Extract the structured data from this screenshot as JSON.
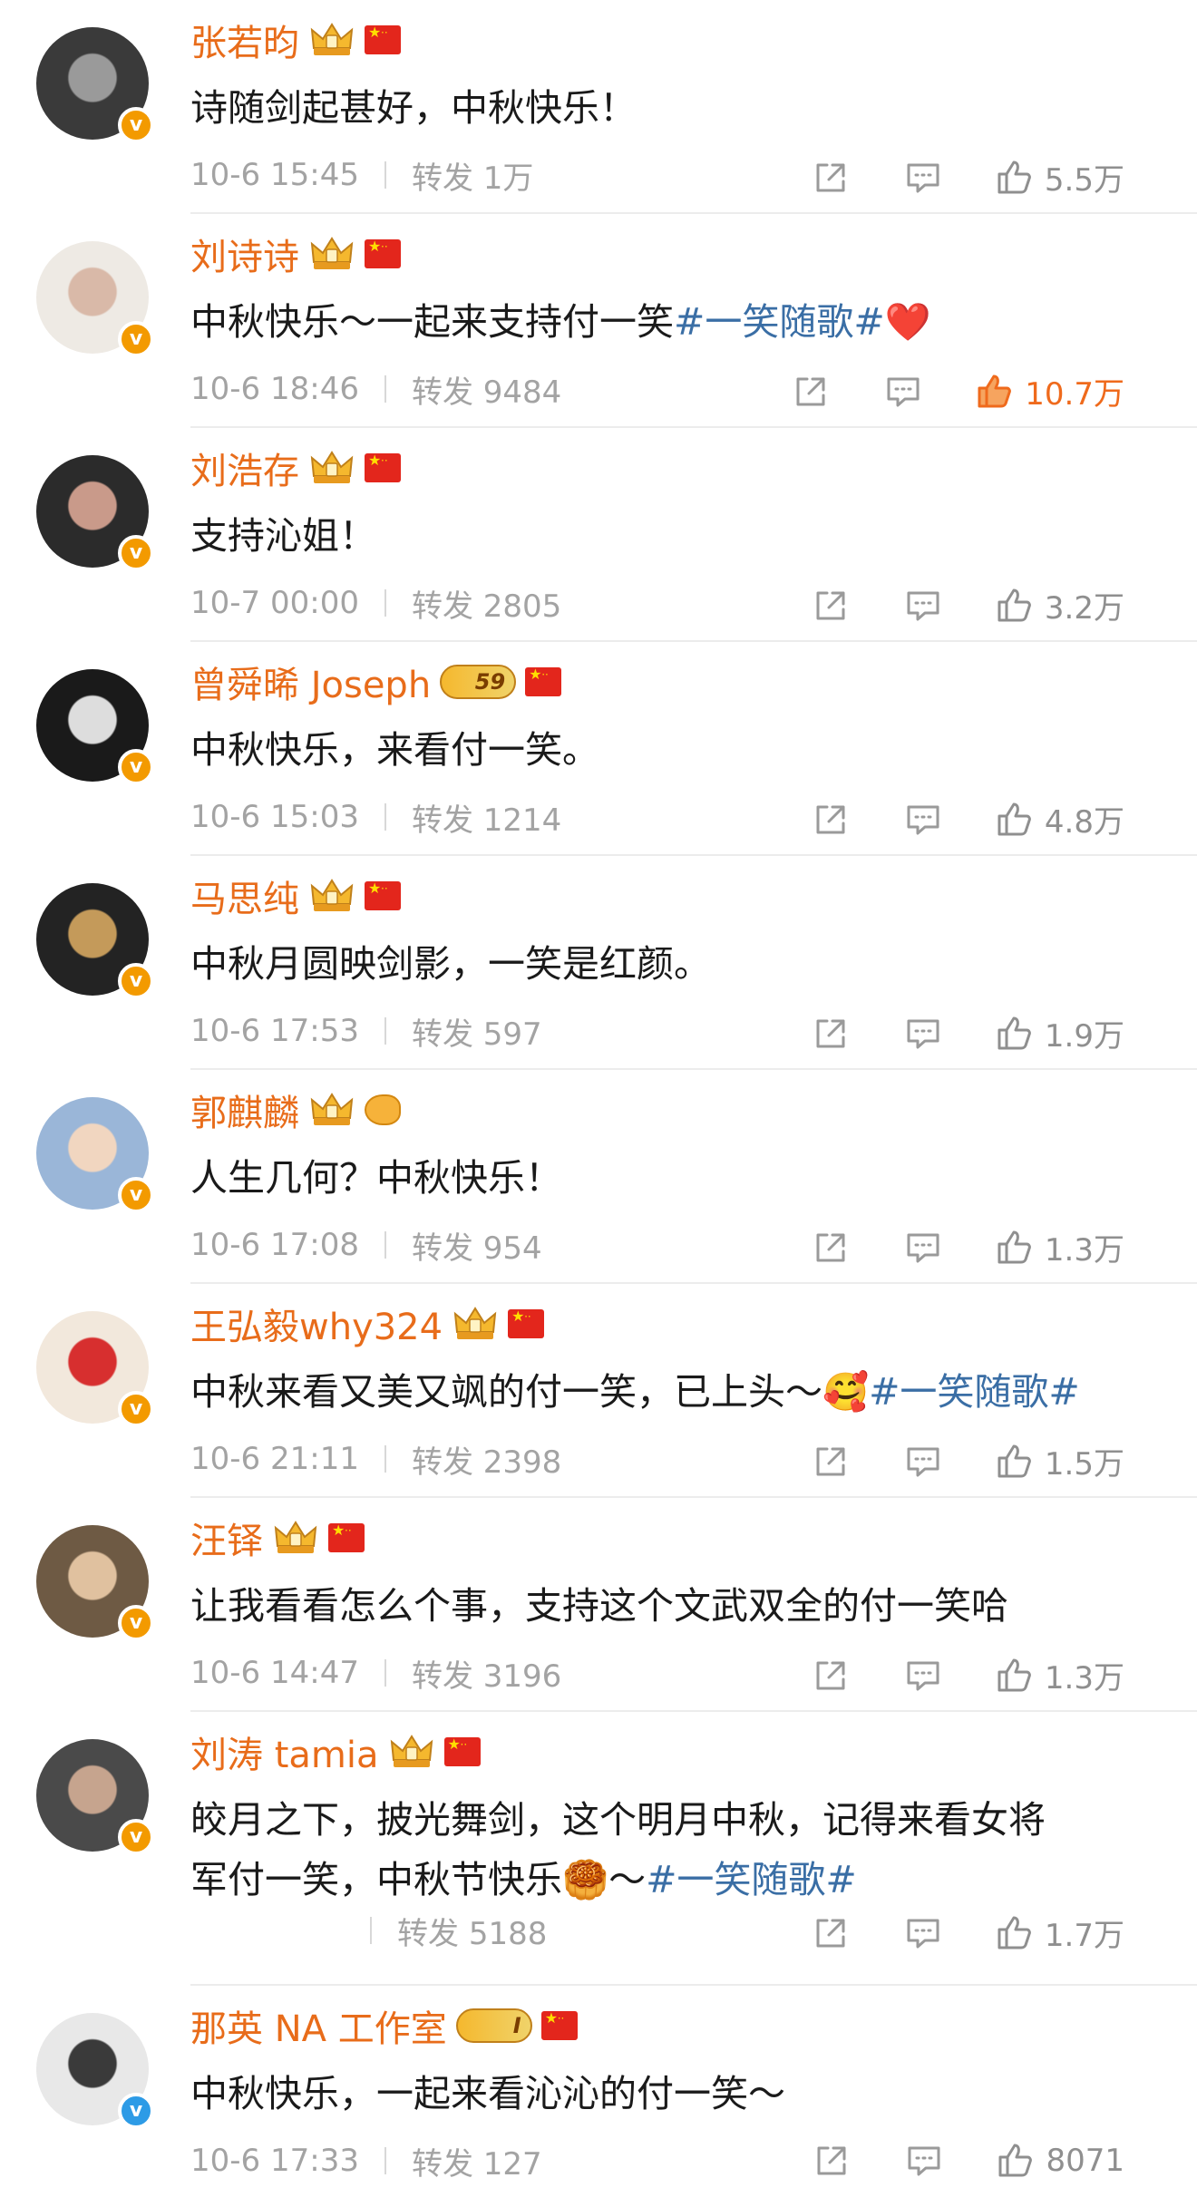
{
  "colors": {
    "name": "#e86c1a",
    "text": "#1a1a1a",
    "meta": "#a3a3a3",
    "hashtag": "#3a6ea5",
    "like_active": "#ef6a1c",
    "verified_orange": "#f39a00",
    "verified_blue": "#2d9be6"
  },
  "labels": {
    "repost": "转发"
  },
  "posts": [
    {
      "name": "张若昀",
      "line1": "诗随剑起甚好，中秋快乐！",
      "time": "10-6 15:45",
      "reposts": "1万",
      "likes": "5.5万",
      "liked": false,
      "verified": "orange",
      "badge": "crown-icon"
    },
    {
      "name": "刘诗诗",
      "line1": "中秋快乐～一起来支持付一笑",
      "tag": "#一笑随歌#",
      "emoji": "❤️",
      "time": "10-6 18:46",
      "reposts": "9484",
      "likes": "10.7万",
      "liked": true,
      "verified": "orange",
      "badge": "crown-icon"
    },
    {
      "name": "刘浩存",
      "line1": "支持沁姐！",
      "time": "10-7 00:00",
      "reposts": "2805",
      "likes": "3.2万",
      "liked": false,
      "verified": "orange",
      "badge": "crown-icon"
    },
    {
      "name": "曾舜晞 Joseph",
      "line1": "中秋快乐，来看付一笑。",
      "time": "10-6 15:03",
      "reposts": "1214",
      "likes": "4.8万",
      "liked": false,
      "verified": "orange",
      "badge": "level-badge",
      "level": "59"
    },
    {
      "name": "马思纯",
      "line1": "中秋月圆映剑影，一笑是红颜。",
      "time": "10-6 17:53",
      "reposts": "597",
      "likes": "1.9万",
      "liked": false,
      "verified": "orange",
      "badge": "crown-icon"
    },
    {
      "name": "郭麒麟",
      "line1": "人生几何？中秋快乐！",
      "time": "10-6 17:08",
      "reposts": "954",
      "likes": "1.3万",
      "liked": false,
      "verified": "orange",
      "badge": "crown-icon",
      "extra": "fish-icon"
    },
    {
      "name": "王弘毅why324",
      "line1": "中秋来看又美又飒的付一笑，已上头～",
      "emoji": "🥰",
      "tag": "#一笑随歌#",
      "time": "10-6 21:11",
      "reposts": "2398",
      "likes": "1.5万",
      "liked": false,
      "verified": "orange",
      "badge": "crown-icon"
    },
    {
      "name": "汪铎",
      "line1": "让我看看怎么个事，支持这个文武双全的付一笑哈",
      "time": "10-6 14:47",
      "reposts": "3196",
      "likes": "1.3万",
      "liked": false,
      "verified": "orange",
      "badge": "crown-icon"
    },
    {
      "name": "刘涛 tamia",
      "line1": "皎月之下，披光舞剑，这个明月中秋，记得来看女将",
      "line2": "军付一笑，中秋节快乐",
      "emoji2": "🥮",
      "line2b": "～",
      "tag2": "#一笑随歌#",
      "time": "",
      "reposts": "5188",
      "likes": "1.7万",
      "liked": false,
      "verified": "orange",
      "badge": "crown-icon"
    },
    {
      "name": "那英 NA 工作室",
      "line1": "中秋快乐，一起来看沁沁的付一笑～",
      "time": "10-6 17:33",
      "reposts": "127",
      "likes": "8071",
      "liked": false,
      "verified": "blue",
      "badge": "level-badge",
      "level": "I"
    }
  ]
}
